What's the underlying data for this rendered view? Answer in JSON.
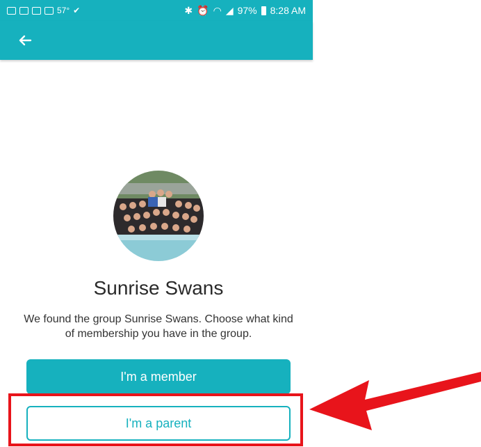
{
  "status_bar": {
    "temperature": "57°",
    "battery_percent": "97%",
    "time": "8:28 AM"
  },
  "app_bar": {
    "back_icon": "arrow-left-icon"
  },
  "group": {
    "name": "Sunrise Swans",
    "description": "We found the group Sunrise Swans. Choose what kind of membership you have in the group."
  },
  "buttons": {
    "member_label": "I'm a member",
    "parent_label": "I'm a parent"
  },
  "colors": {
    "accent": "#16b1be",
    "highlight": "#e8141b"
  }
}
